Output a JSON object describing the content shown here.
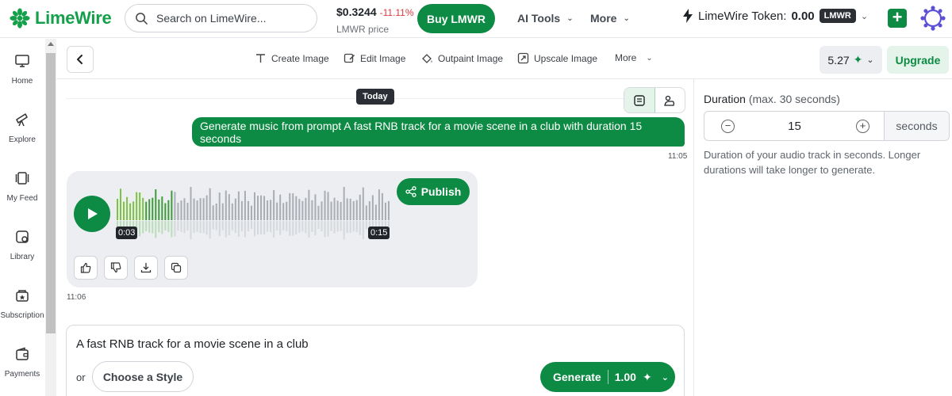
{
  "brand": {
    "name": "LimeWire",
    "color": "#0d8a43"
  },
  "search": {
    "placeholder": "Search on LimeWire..."
  },
  "price": {
    "value": "$0.3244",
    "change": "-11.11%",
    "label": "LMWR price"
  },
  "header": {
    "buy_label": "Buy LMWR",
    "ai_tools_label": "AI Tools",
    "more_label": "More",
    "token_label": "LimeWire Token:",
    "token_value": "0.00",
    "token_badge": "LMWR"
  },
  "sidebar": {
    "items": [
      {
        "label": "Home",
        "icon": "monitor-icon"
      },
      {
        "label": "Explore",
        "icon": "telescope-icon"
      },
      {
        "label": "My Feed",
        "icon": "feed-icon"
      },
      {
        "label": "Library",
        "icon": "library-icon"
      },
      {
        "label": "Subscription",
        "icon": "subscription-icon"
      },
      {
        "label": "Payments",
        "icon": "wallet-icon"
      }
    ]
  },
  "toolbar": {
    "tools": [
      "Create Image",
      "Edit Image",
      "Outpaint Image",
      "Upscale Image"
    ],
    "more_label": "More",
    "credits": "5.27",
    "upgrade_label": "Upgrade"
  },
  "chat": {
    "date_label": "Today",
    "user_message": "Generate music from prompt A fast RNB track for a movie scene in a club with duration 15 seconds",
    "user_time": "11:05",
    "audio": {
      "current_time": "0:03",
      "duration": "0:15",
      "progress": 0.2
    },
    "publish_label": "Publish",
    "reply_time": "11:06"
  },
  "composer": {
    "prompt": "A fast RNB track for a movie scene in a club",
    "or_label": "or",
    "style_label": "Choose a Style",
    "generate_label": "Generate",
    "generate_cost": "1.00"
  },
  "settings": {
    "duration_label": "Duration",
    "duration_hint": "(max. 30 seconds)",
    "duration_value": "15",
    "duration_unit": "seconds",
    "duration_help": "Duration of your audio track in seconds. Longer durations will take longer to generate."
  }
}
